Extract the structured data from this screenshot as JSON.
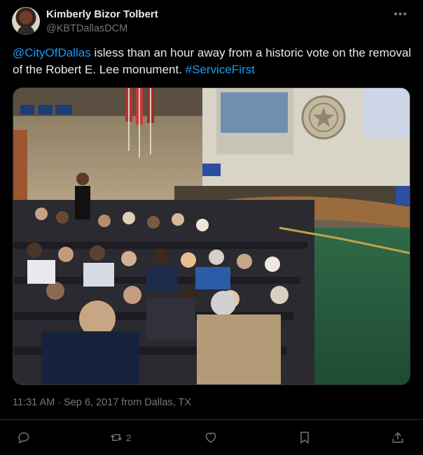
{
  "author": {
    "name": "Kimberly Bizor Tolbert",
    "handle": "@KBTDallasDCM"
  },
  "tweet": {
    "mention": "@CityOfDallas",
    "body": " isless than an hour away from a historic vote on the removal of the Robert E. Lee monument. ",
    "hashtag": "#ServiceFirst",
    "timestamp": "11:31 AM · Sep 6, 2017 from Dallas, TX"
  },
  "media": {
    "seal_text": "CITY OF DALLAS"
  },
  "actions": {
    "reply_icon": "reply-icon",
    "retweet_icon": "retweet-icon",
    "retweet_count": "2",
    "like_icon": "heart-icon",
    "bookmark_icon": "bookmark-icon",
    "share_icon": "share-icon"
  },
  "colors": {
    "background": "#000000",
    "text": "#e7e9ea",
    "secondary": "#71767b",
    "link": "#1d9bf0",
    "border": "#2f3336"
  }
}
